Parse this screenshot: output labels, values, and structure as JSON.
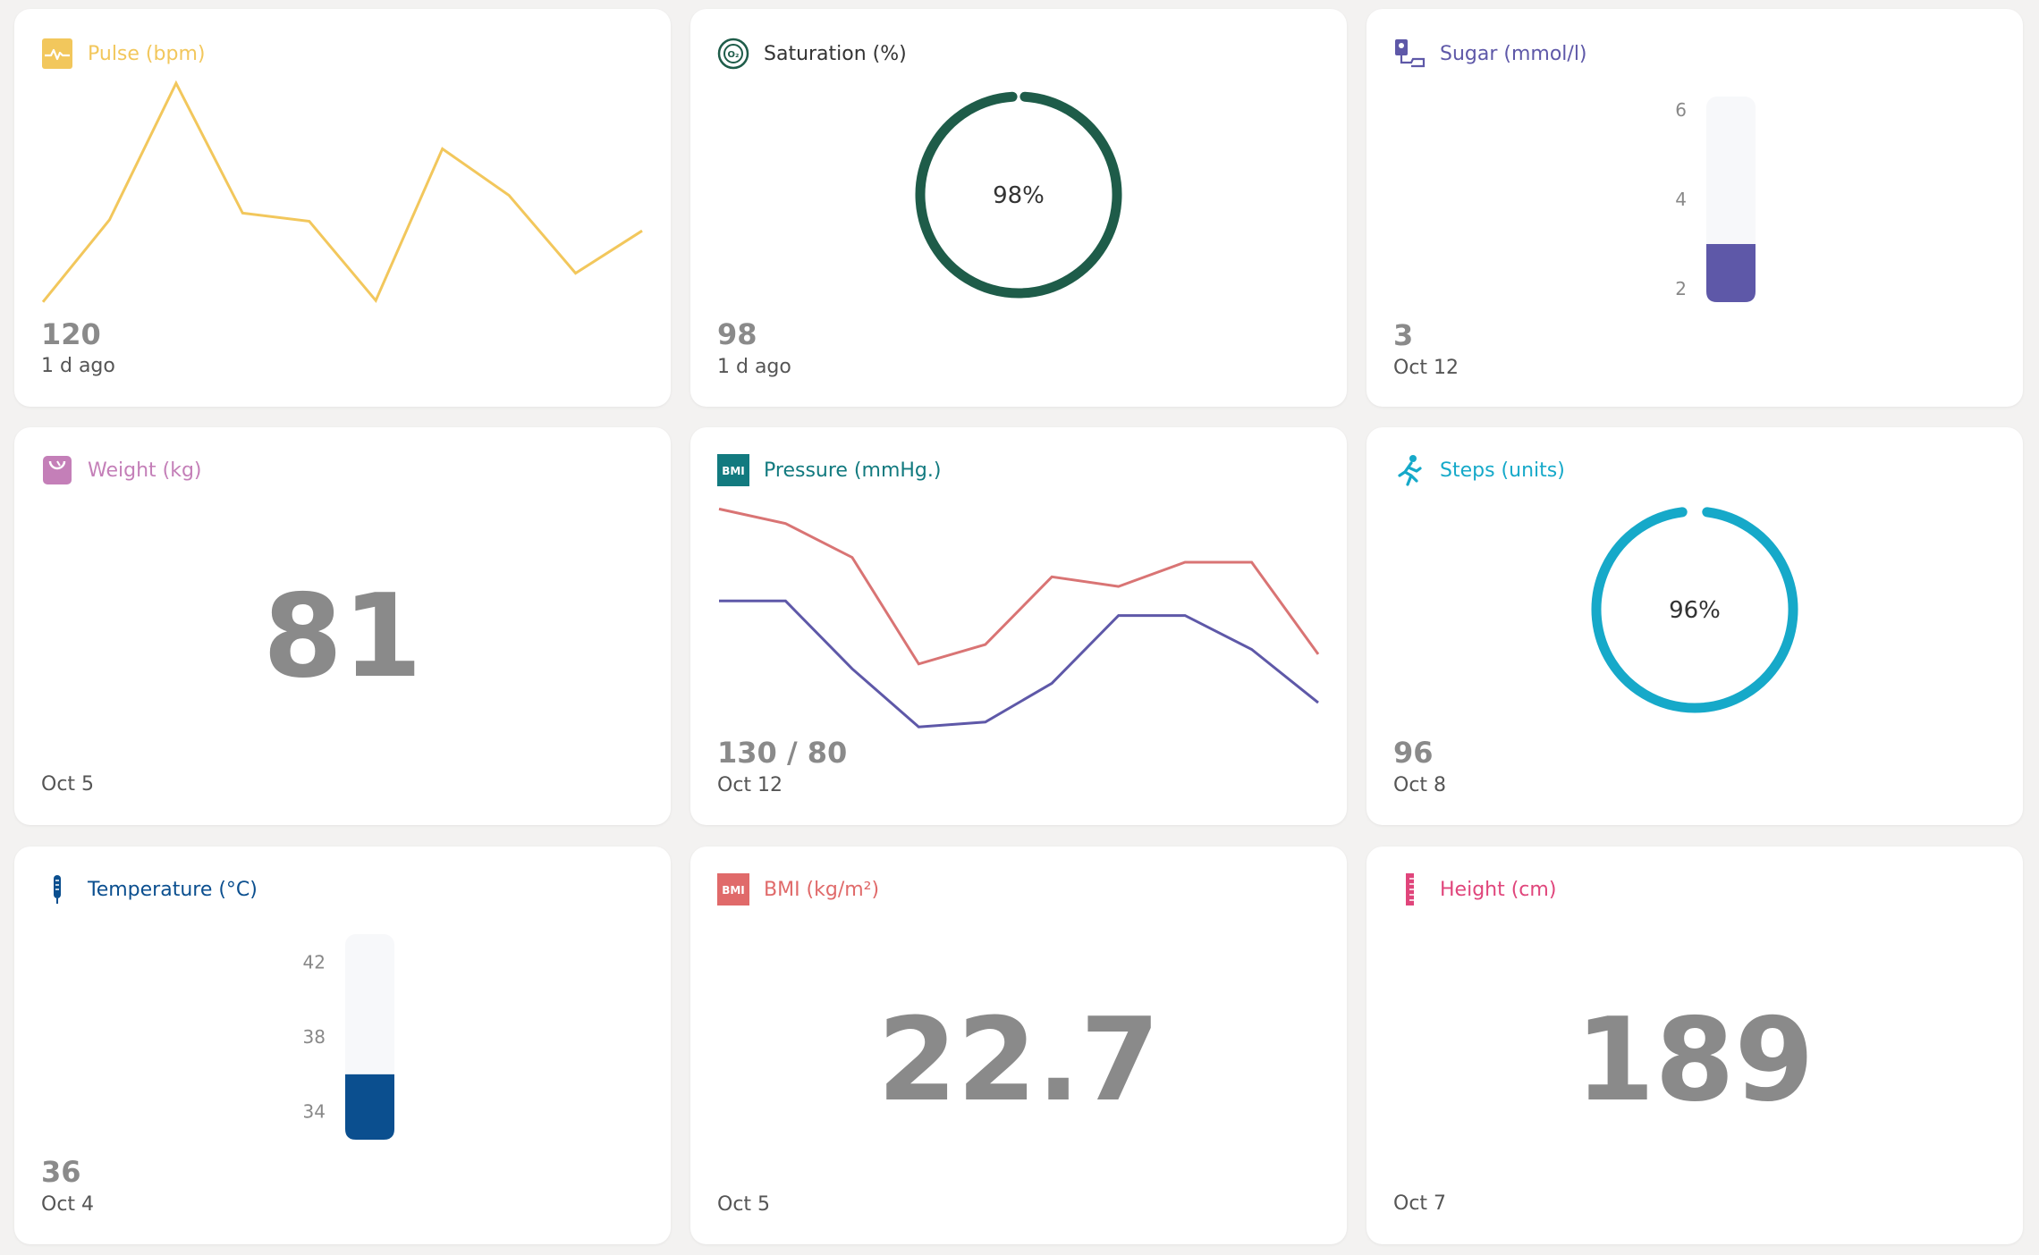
{
  "pulse": {
    "title": "Pulse (bpm)",
    "value": "120",
    "date": "1 d ago",
    "color": "#f2c75c",
    "icon": "heart-pulse-icon",
    "chart_data": {
      "type": "line",
      "series": [
        {
          "values": [
            38,
            98,
            198,
            103,
            97,
            39,
            150,
            116,
            59,
            90
          ]
        }
      ]
    }
  },
  "saturation": {
    "title": "Saturation (%)",
    "value": "98",
    "date": "1 d ago",
    "color": "#1e5c49",
    "icon": "oxygen-o2-icon",
    "chart_data": {
      "type": "gauge",
      "value": 98,
      "max": 100,
      "label": "98%"
    }
  },
  "sugar": {
    "title": "Sugar (mmol/l)",
    "value": "3",
    "date": "Oct 12",
    "color": "#5e58a8",
    "icon": "glucose-meter-icon",
    "chart_data": {
      "type": "thermometer-bar",
      "value": 3,
      "ylim": [
        1.7,
        6.3
      ],
      "ticks": [
        "6",
        "4",
        "2"
      ]
    }
  },
  "weight": {
    "title": "Weight (kg)",
    "value": "81",
    "date": "Oct 5",
    "color": "#c47fb8",
    "icon": "scale-icon"
  },
  "pressure": {
    "title": "Pressure (mmHg.)",
    "value": "130 / 80",
    "date": "Oct 12",
    "color": "#127a7f",
    "icon": "bmi-badge-icon",
    "icon_text": "BMI",
    "chart_data": {
      "type": "line",
      "series": [
        {
          "values": [
            147,
            144,
            137,
            115,
            119,
            133,
            131,
            136,
            136,
            117
          ],
          "color": "#d97474"
        },
        {
          "values": [
            128,
            128,
            114,
            102,
            103,
            111,
            125,
            125,
            118,
            107
          ],
          "color": "#5e58a8"
        }
      ]
    }
  },
  "steps": {
    "title": "Steps (units)",
    "value": "96",
    "date": "Oct 8",
    "color": "#16a9c9",
    "icon": "running-person-icon",
    "chart_data": {
      "type": "gauge",
      "value": 96,
      "max": 100,
      "label": "96%"
    }
  },
  "temperature": {
    "title": "Temperature (°C)",
    "value": "36",
    "date": "Oct 4",
    "color": "#0b4f8f",
    "icon": "thermometer-icon",
    "chart_data": {
      "type": "thermometer-bar",
      "value": 36,
      "ylim": [
        32.5,
        43.5
      ],
      "ticks": [
        "42",
        "38",
        "34"
      ]
    }
  },
  "bmi": {
    "title": "BMI (kg/m²)",
    "value": "22.7",
    "date": "Oct 5",
    "color": "#e06a6a",
    "icon": "bmi-badge-icon",
    "icon_text": "BMI"
  },
  "height": {
    "title": "Height (cm)",
    "value": "189",
    "date": "Oct 7",
    "color": "#e0457b",
    "icon": "ruler-icon"
  }
}
